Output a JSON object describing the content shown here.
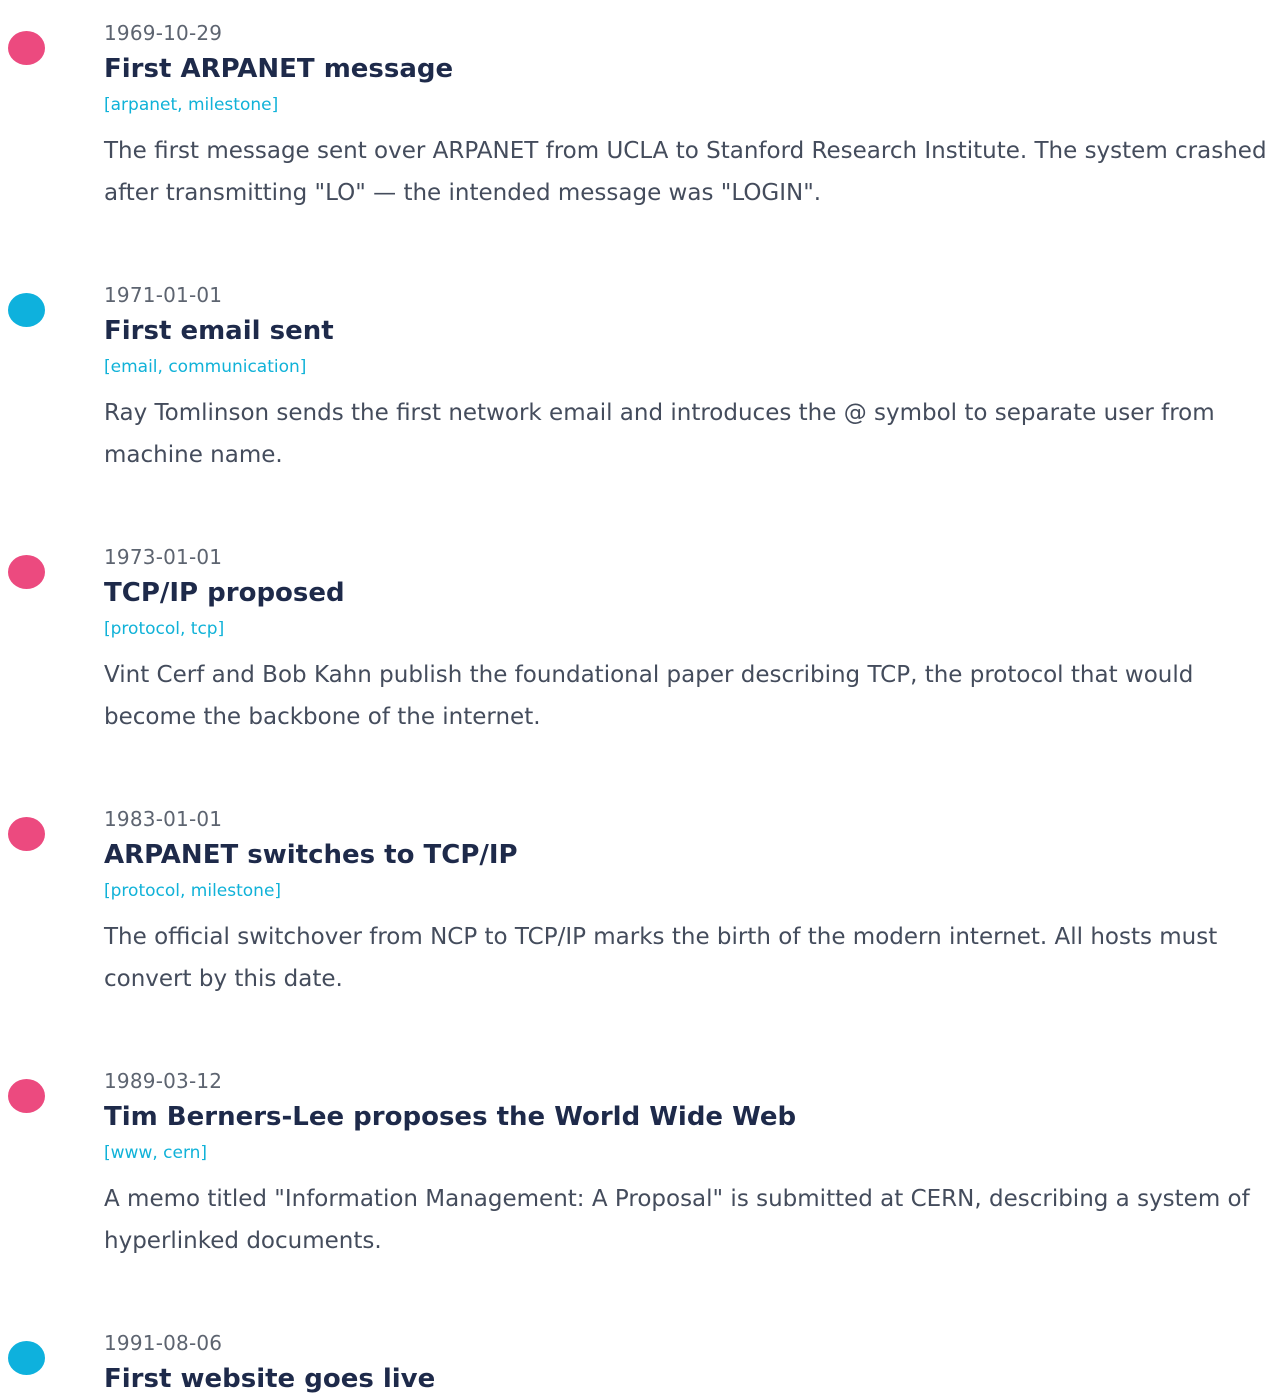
{
  "colors": {
    "pink": "#ec4a7f",
    "cyan": "#0eb1dd"
  },
  "events": [
    {
      "date": "1969-10-29",
      "title": "First ARPANET message",
      "tags": "[arpanet, milestone]",
      "description": "The first message sent over ARPANET from UCLA to Stanford Research Institute. The system crashed after transmitting \"LO\" — the intended message was \"LOGIN\".",
      "dot_color": "pink"
    },
    {
      "date": "1971-01-01",
      "title": "First email sent",
      "tags": "[email, communication]",
      "description": "Ray Tomlinson sends the first network email and introduces the @ symbol to separate user from machine name.",
      "dot_color": "cyan"
    },
    {
      "date": "1973-01-01",
      "title": "TCP/IP proposed",
      "tags": "[protocol, tcp]",
      "description": "Vint Cerf and Bob Kahn publish the foundational paper describing TCP, the protocol that would become the backbone of the internet.",
      "dot_color": "pink"
    },
    {
      "date": "1983-01-01",
      "title": "ARPANET switches to TCP/IP",
      "tags": "[protocol, milestone]",
      "description": "The official switchover from NCP to TCP/IP marks the birth of the modern internet. All hosts must convert by this date.",
      "dot_color": "pink"
    },
    {
      "date": "1989-03-12",
      "title": "Tim Berners-Lee proposes the World Wide Web",
      "tags": "[www, cern]",
      "description": "A memo titled \"Information Management: A Proposal\" is submitted at CERN, describing a system of hyperlinked documents.",
      "dot_color": "pink"
    },
    {
      "date": "1991-08-06",
      "title": "First website goes live",
      "tags": "",
      "description": "",
      "dot_color": "cyan"
    }
  ]
}
